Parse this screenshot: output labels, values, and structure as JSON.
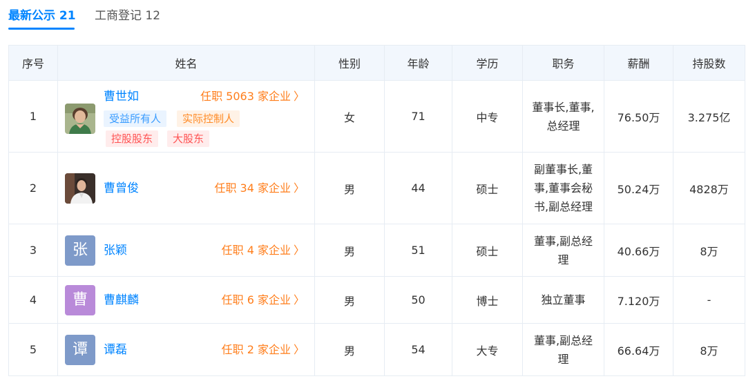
{
  "tabs": [
    {
      "label": "最新公示 21"
    },
    {
      "label": "工商登记 12"
    }
  ],
  "table": {
    "headers": [
      "序号",
      "姓名",
      "性别",
      "年龄",
      "学历",
      "职务",
      "薪酬",
      "持股数"
    ],
    "rows": [
      {
        "index": "1",
        "name": "曹世如",
        "posts": "任职 5063 家企业",
        "tags": [
          "受益所有人",
          "实际控制人",
          "控股股东",
          "大股东"
        ],
        "gender": "女",
        "age": "71",
        "education": "中专",
        "role_lines": [
          "董事长,董事,",
          "总经理"
        ],
        "salary": "76.50万",
        "shares": "3.275亿"
      },
      {
        "index": "2",
        "name": "曹曾俊",
        "posts": "任职 34 家企业",
        "gender": "男",
        "age": "44",
        "education": "硕士",
        "role_lines": [
          "副董事长,董",
          "事,董事会秘",
          "书,副总经理"
        ],
        "salary": "50.24万",
        "shares": "4828万"
      },
      {
        "index": "3",
        "name": "张颖",
        "avatar_char": "张",
        "avatar_color": "#7e9ac9",
        "posts": "任职 4 家企业",
        "gender": "男",
        "age": "51",
        "education": "硕士",
        "role_lines": [
          "董事,副总经",
          "理"
        ],
        "salary": "40.66万",
        "shares": "8万"
      },
      {
        "index": "4",
        "name": "曹麒麟",
        "avatar_char": "曹",
        "avatar_color": "#b98ad9",
        "posts": "任职 6 家企业",
        "gender": "男",
        "age": "50",
        "education": "博士",
        "role_lines": [
          "独立董事"
        ],
        "salary": "7.120万",
        "shares": "-"
      },
      {
        "index": "5",
        "name": "谭磊",
        "avatar_char": "谭",
        "avatar_color": "#7e9ac9",
        "posts": "任职 2 家企业",
        "gender": "男",
        "age": "54",
        "education": "大专",
        "role_lines": [
          "董事,副总经",
          "理"
        ],
        "salary": "66.64万",
        "shares": "8万"
      }
    ]
  },
  "icons": {
    "chevron": "chevron-right-icon",
    "chevron_glyph": "〉"
  },
  "colors": {
    "accent": "#0084ff",
    "link_orange": "#ff7d1a"
  }
}
